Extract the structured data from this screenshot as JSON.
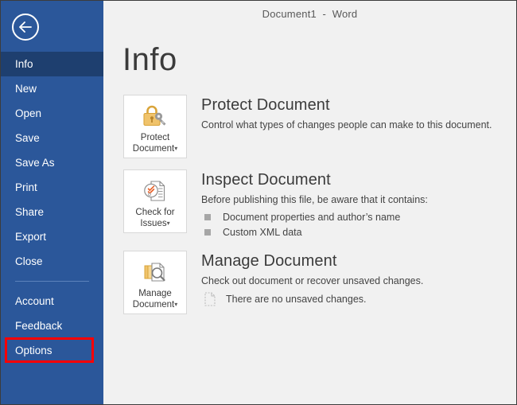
{
  "window": {
    "title": "Document1  -  Word",
    "accent_color": "#2b579a",
    "selected_color": "#1e3f6f",
    "callout_color": "#ff0000",
    "content_background": "#f1f1f1"
  },
  "sidebar": {
    "back_button": {
      "name": "back-arrow-icon",
      "label": "Back"
    },
    "items": [
      {
        "label": "Info",
        "selected": true,
        "callout": false
      },
      {
        "label": "New",
        "selected": false,
        "callout": false
      },
      {
        "label": "Open",
        "selected": false,
        "callout": false
      },
      {
        "label": "Save",
        "selected": false,
        "callout": false
      },
      {
        "label": "Save As",
        "selected": false,
        "callout": false
      },
      {
        "label": "Print",
        "selected": false,
        "callout": false
      },
      {
        "label": "Share",
        "selected": false,
        "callout": false
      },
      {
        "label": "Export",
        "selected": false,
        "callout": false
      },
      {
        "label": "Close",
        "selected": false,
        "callout": false
      }
    ],
    "items_bottom": [
      {
        "label": "Account",
        "selected": false,
        "callout": false
      },
      {
        "label": "Feedback",
        "selected": false,
        "callout": false
      },
      {
        "label": "Options",
        "selected": false,
        "callout": true
      }
    ]
  },
  "main": {
    "page_title": "Info",
    "sections": [
      {
        "button_label_line1": "Protect",
        "button_label_line2": "Document",
        "button_caret": "▾",
        "icon": "padlock-key-icon",
        "title": "Protect Document",
        "description": "Control what types of changes people can make to this document.",
        "bullets": [],
        "status": null
      },
      {
        "button_label_line1": "Check for",
        "button_label_line2": "Issues",
        "button_caret": "▾",
        "icon": "document-inspect-icon",
        "title": "Inspect Document",
        "description": "Before publishing this file, be aware that it contains:",
        "bullets": [
          "Document properties and author’s name",
          "Custom XML data"
        ],
        "status": null
      },
      {
        "button_label_line1": "Manage",
        "button_label_line2": "Document",
        "button_caret": "▾",
        "icon": "document-stack-search-icon",
        "title": "Manage Document",
        "description": "Check out document or recover unsaved changes.",
        "bullets": [],
        "status": "There are no unsaved changes."
      }
    ]
  }
}
